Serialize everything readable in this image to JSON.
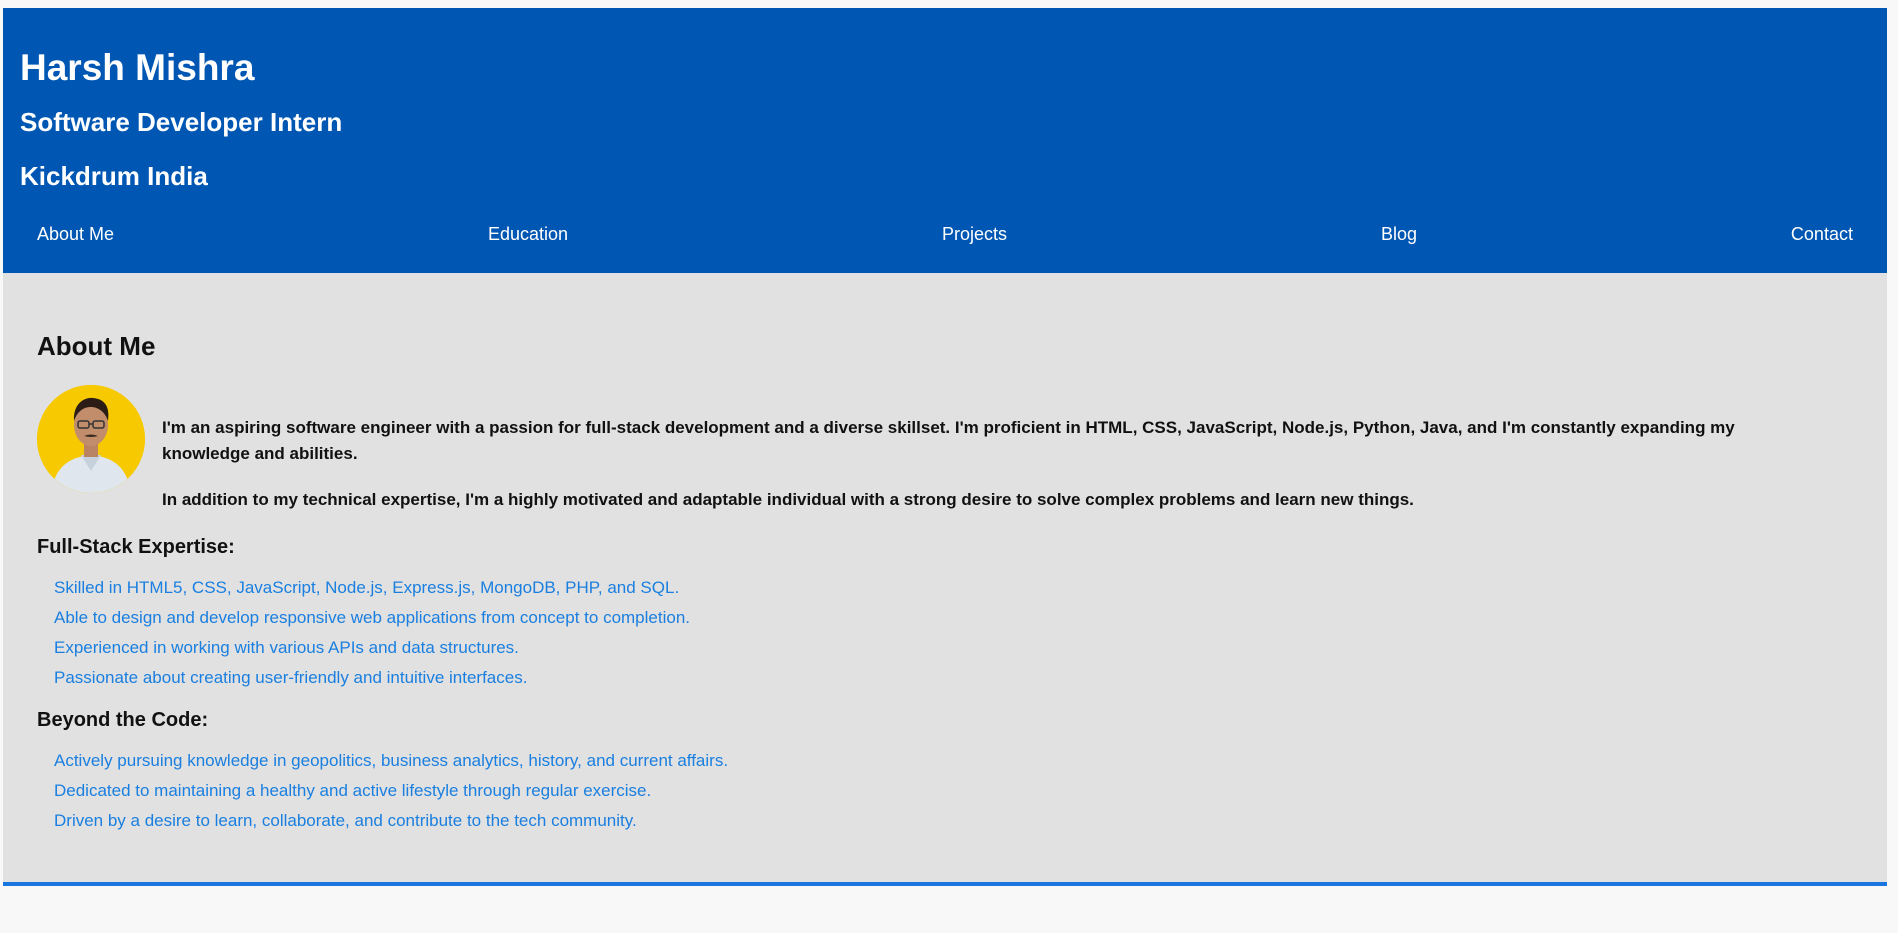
{
  "header": {
    "name": "Harsh Mishra",
    "role": "Software Developer Intern",
    "company": "Kickdrum India"
  },
  "nav": {
    "items": [
      "About Me",
      "Education",
      "Projects",
      "Blog",
      "Contact"
    ]
  },
  "about": {
    "heading": "About Me",
    "intro_1": "I'm an aspiring software engineer with a passion for full-stack development and a diverse skillset. I'm proficient in HTML, CSS, JavaScript, Node.js, Python, Java, and I'm constantly expanding my knowledge and abilities.",
    "intro_2": "In addition to my technical expertise, I'm a highly motivated and adaptable individual with a strong desire to solve complex problems and learn new things.",
    "fullstack_heading": "Full-Stack Expertise:",
    "fullstack_items": [
      "Skilled in HTML5, CSS, JavaScript, Node.js, Express.js, MongoDB, PHP, and SQL.",
      "Able to design and develop responsive web applications from concept to completion.",
      "Experienced in working with various APIs and data structures.",
      "Passionate about creating user-friendly and intuitive interfaces."
    ],
    "beyond_heading": "Beyond the Code:",
    "beyond_items": [
      "Actively pursuing knowledge in geopolitics, business analytics, history, and current affairs.",
      "Dedicated to maintaining a healthy and active lifestyle through regular exercise.",
      "Driven by a desire to learn, collaborate, and contribute to the tech community."
    ]
  },
  "colors": {
    "header_bg": "#0056b3",
    "content_bg": "#e1e1e1",
    "link_blue": "#1a7fe0",
    "avatar_bg": "#f6c900"
  }
}
